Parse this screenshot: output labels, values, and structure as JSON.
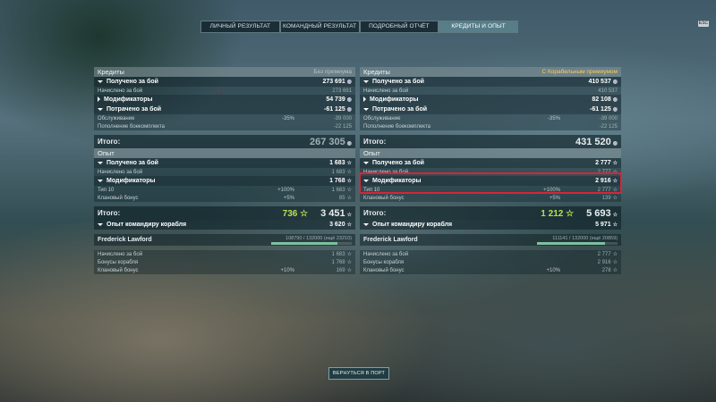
{
  "tabs": [
    "ЛИЧНЫЙ РЕЗУЛЬТАТ",
    "КОМАНДНЫЙ РЕЗУЛЬТАТ",
    "ПОДРОБНЫЙ ОТЧЁТ",
    "КРЕДИТЫ И ОПЫТ"
  ],
  "active_tab": 3,
  "corner_badge": "ESC",
  "left": {
    "credits": {
      "title": "Кредиты",
      "subtitle": "Без премиума",
      "earned_label": "Получено за бой",
      "earned_value": "273 691",
      "accrued_label": "Начислено за бой",
      "accrued_value": "273 691",
      "modifiers_label": "Модификаторы",
      "modifiers_value": "54 739",
      "spent_label": "Потрачено за бой",
      "spent_value": "-61 125",
      "service_label": "Обслуживание",
      "service_pct": "-35%",
      "service_value": "-39 000",
      "ammo_label": "Пополнение боекомплекта",
      "ammo_value": "-22 125",
      "total_label": "Итого:",
      "total_value": "267 305"
    },
    "xp": {
      "title": "Опыт",
      "earned_label": "Получено за бой",
      "earned_value": "1 683",
      "accrued_label": "Начислено за бой",
      "accrued_value": "1 683",
      "modifiers_label": "Модификаторы",
      "modifiers_value": "1 768",
      "tier_label": "Тип 10",
      "tier_pct": "+100%",
      "tier_value": "1 683",
      "clan_label": "Клановый бонус",
      "clan_pct": "+5%",
      "clan_value": "85",
      "total_label": "Итого:",
      "total_free": "736",
      "total_value": "3 451"
    },
    "commander": {
      "title": "Опыт командиру корабля",
      "title_value": "3 620",
      "name": "Frederick Lawford",
      "progress_text": "108790 / 132000 (ещё 23210)",
      "progress": 0.824,
      "accrued_label": "Начислено за бой",
      "accrued_value": "1 683",
      "ship_label": "Бонусы корабля",
      "ship_value": "1 768",
      "clan_label": "Клановый бонус",
      "clan_pct": "+10%",
      "clan_value": "169"
    }
  },
  "right": {
    "credits": {
      "title": "Кредиты",
      "subtitle": "С Корабельным премиумом",
      "earned_label": "Получено за бой",
      "earned_value": "410 537",
      "accrued_label": "Начислено за бой",
      "accrued_value": "410 537",
      "modifiers_label": "Модификаторы",
      "modifiers_value": "82 108",
      "spent_label": "Потрачено за бой",
      "spent_value": "-61 125",
      "service_label": "Обслуживание",
      "service_pct": "-35%",
      "service_value": "-39 000",
      "ammo_label": "Пополнение боекомплекта",
      "ammo_value": "-22 125",
      "total_label": "Итого:",
      "total_value": "431 520"
    },
    "xp": {
      "title": "Опыт",
      "earned_label": "Получено за бой",
      "earned_value": "2 777",
      "accrued_label": "Начислено за бой",
      "accrued_value": "2 777",
      "modifiers_label": "Модификаторы",
      "modifiers_value": "2 916",
      "tier_label": "Тип 10",
      "tier_pct": "+100%",
      "tier_value": "2 777",
      "clan_label": "Клановый бонус",
      "clan_pct": "+5%",
      "clan_value": "139",
      "total_label": "Итого:",
      "total_free": "1 212",
      "total_value": "5 693"
    },
    "commander": {
      "title": "Опыт командиру корабля",
      "title_value": "5 971",
      "name": "Frederick Lawford",
      "progress_text": "111141 / 132000 (ещё 20859)",
      "progress": 0.842,
      "accrued_label": "Начислено за бой",
      "accrued_value": "2 777",
      "ship_label": "Бонусы корабля",
      "ship_value": "2 916",
      "clan_label": "Клановый бонус",
      "clan_pct": "+10%",
      "clan_value": "278"
    }
  },
  "back_button": "ВЕРНУТЬСЯ В ПОРТ"
}
